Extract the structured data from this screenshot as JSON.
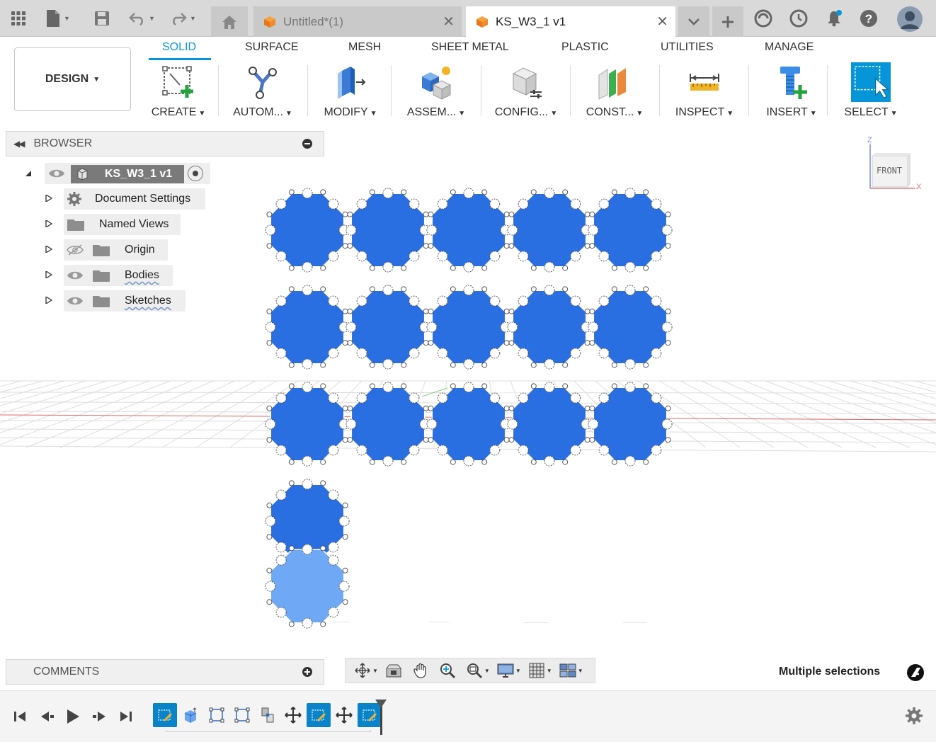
{
  "titlebar": {
    "tabs": [
      {
        "label": "Untitled*(1)",
        "active": false
      },
      {
        "label": "KS_W3_1 v1",
        "active": true
      }
    ],
    "icons": [
      "apps-grid-icon",
      "file-icon",
      "save-icon",
      "undo-icon",
      "redo-icon",
      "home-icon",
      "chevron-down-icon",
      "plus-icon",
      "extensions-icon",
      "history-clock-icon",
      "notifications-bell-icon",
      "help-icon",
      "user-avatar-icon"
    ]
  },
  "ribbon": {
    "workspace": "DESIGN",
    "tabs": [
      "SOLID",
      "SURFACE",
      "MESH",
      "SHEET METAL",
      "PLASTIC",
      "UTILITIES",
      "MANAGE"
    ],
    "active_tab": "SOLID",
    "groups": [
      {
        "label": "CREATE",
        "icon": "create-sketch-icon"
      },
      {
        "label": "AUTOM...",
        "icon": "automate-icon"
      },
      {
        "label": "MODIFY",
        "icon": "modify-icon"
      },
      {
        "label": "ASSEM...",
        "icon": "assemble-icon"
      },
      {
        "label": "CONFIG...",
        "icon": "configure-icon"
      },
      {
        "label": "CONST...",
        "icon": "construct-icon"
      },
      {
        "label": "INSPECT",
        "icon": "inspect-icon"
      },
      {
        "label": "INSERT",
        "icon": "insert-icon"
      },
      {
        "label": "SELECT",
        "icon": "select-icon"
      }
    ]
  },
  "browser": {
    "title": "BROWSER",
    "root": "KS_W3_1 v1",
    "items": [
      {
        "label": "Document Settings",
        "icon": "gear-icon"
      },
      {
        "label": "Named Views",
        "icon": "folder-icon"
      },
      {
        "label": "Origin",
        "icon": "folder-icon",
        "visibility": "hidden"
      },
      {
        "label": "Bodies",
        "icon": "folder-icon",
        "visibility": "visible"
      },
      {
        "label": "Sketches",
        "icon": "folder-icon",
        "visibility": "visible"
      }
    ]
  },
  "viewcube": {
    "face": "FRONT",
    "axes": [
      "Z",
      "X"
    ]
  },
  "canvas": {
    "octagon_grid": {
      "rows": 3,
      "cols": 5,
      "extra_below": 2,
      "last_light": true
    },
    "colors": {
      "body_blue": "#2a6fe2",
      "light_blue": "#6fa8f4",
      "grid_line": "#dddddd",
      "x_axis": "#e06666"
    }
  },
  "comments": {
    "title": "COMMENTS"
  },
  "navbar": {
    "icons": [
      "orbit-icon",
      "look-at-icon",
      "pan-icon",
      "zoom-icon",
      "zoom-window-icon",
      "display-settings-icon",
      "grid-settings-icon",
      "viewports-icon"
    ]
  },
  "status": {
    "text": "Multiple selections"
  },
  "timeline": {
    "controls": [
      "skip-start-icon",
      "step-back-icon",
      "play-icon",
      "step-forward-icon",
      "skip-end-icon"
    ],
    "features": [
      "sketch",
      "extrude",
      "rect-pattern",
      "rect-pattern",
      "joint",
      "move",
      "sketch",
      "move",
      "sketch"
    ]
  }
}
